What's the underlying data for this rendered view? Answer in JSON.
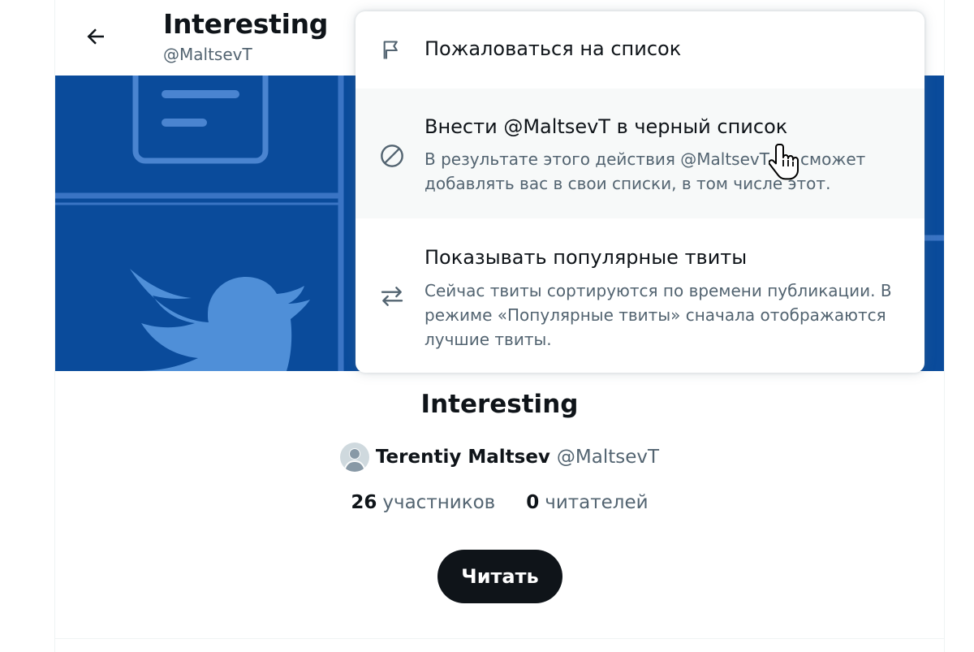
{
  "header": {
    "back_icon": "arrow-left-icon",
    "title": "Interesting",
    "subtitle": "@MaltsevT"
  },
  "banner": {
    "background_color": "#0a4b9b",
    "illustration": "list-illustration-with-bird"
  },
  "list": {
    "title": "Interesting",
    "owner_name": "Terentiy Maltsev",
    "owner_handle": "@MaltsevT",
    "members_count": "26",
    "members_label": "участников",
    "followers_count": "0",
    "followers_label": "читателей",
    "follow_button": "Читать"
  },
  "menu": {
    "items": [
      {
        "icon": "flag-icon",
        "title": "Пожаловаться на список",
        "description": ""
      },
      {
        "icon": "block-icon",
        "title": "Внести @MaltsevT в черный список",
        "description": "В результате этого действия @MaltsevT не сможет добавлять вас в свои списки, в том числе этот."
      },
      {
        "icon": "swap-arrows-icon",
        "title": "Показывать популярные твиты",
        "description": "Сейчас твиты сортируются по времени публикации. В режиме «Популярные твиты» сначала отображаются лучшие твиты."
      }
    ]
  },
  "colors": {
    "text_primary": "#0f1419",
    "text_secondary": "#536471",
    "banner": "#0a4b9b",
    "button": "#0f1419",
    "menu_hover": "#f7f9f9"
  }
}
